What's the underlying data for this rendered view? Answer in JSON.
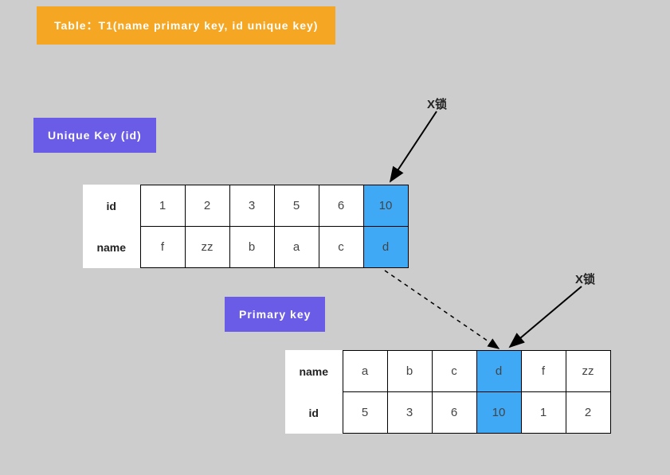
{
  "title": "Table：T1(name  primary  key, id  unique  key)",
  "badges": {
    "unique": "Unique  Key  (id)",
    "primary": "Primary key"
  },
  "lock_labels": {
    "l1": "X锁",
    "l2": "X锁"
  },
  "upper_table": {
    "row1_label": "id",
    "row2_label": "name",
    "row1": [
      "1",
      "2",
      "3",
      "5",
      "6",
      "10"
    ],
    "row2": [
      "f",
      "zz",
      "b",
      "a",
      "c",
      "d"
    ],
    "highlight_col": 5
  },
  "lower_table": {
    "row1_label": "name",
    "row2_label": "id",
    "row1": [
      "a",
      "b",
      "c",
      "d",
      "f",
      "zz"
    ],
    "row2": [
      "5",
      "3",
      "6",
      "10",
      "1",
      "2"
    ],
    "highlight_col": 3
  },
  "colors": {
    "page_bg": "#cdcdcd",
    "title_bg": "#f5a623",
    "badge_bg": "#6b5ce7",
    "highlight": "#3fa9f5"
  }
}
